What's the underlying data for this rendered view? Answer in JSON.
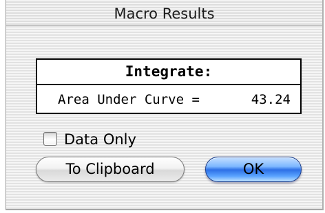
{
  "window": {
    "title": "Macro Results"
  },
  "results": {
    "header": "Integrate:",
    "label": "Area Under Curve =",
    "value": "43.24"
  },
  "options": {
    "data_only_label": "Data Only",
    "data_only_checked": false
  },
  "buttons": {
    "clipboard_label": "To Clipboard",
    "ok_label": "OK"
  },
  "colors": {
    "default_button": "#2d6fe6",
    "panel_background": "#ececec"
  }
}
